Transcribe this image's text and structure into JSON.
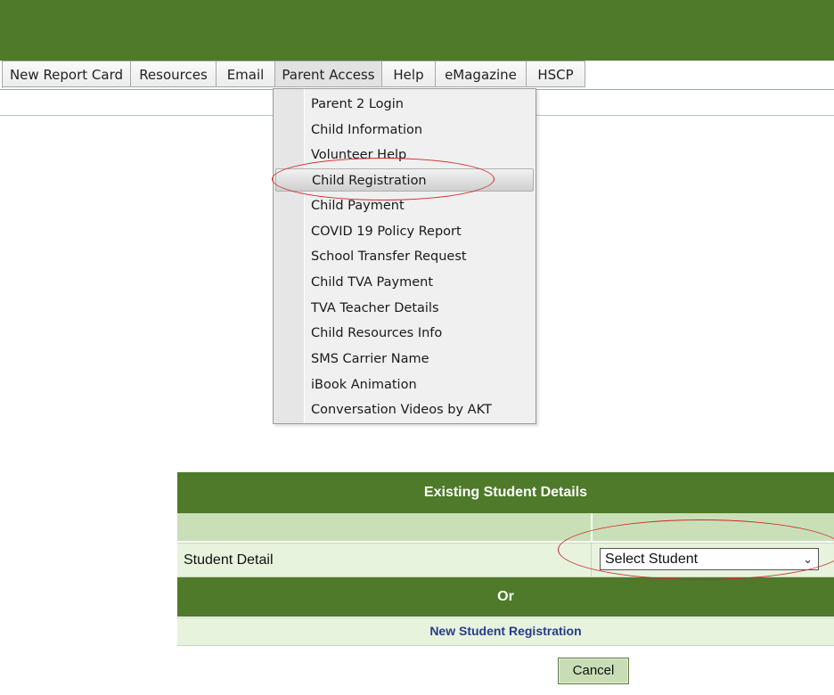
{
  "menu": {
    "items": [
      {
        "label": "New Report Card"
      },
      {
        "label": "Resources"
      },
      {
        "label": "Email"
      },
      {
        "label": "Parent Access"
      },
      {
        "label": "Help"
      },
      {
        "label": "eMagazine"
      },
      {
        "label": "HSCP"
      }
    ],
    "active": "Parent Access"
  },
  "dropdown": {
    "items": [
      "Parent 2 Login",
      "Child Information",
      "Volunteer Help",
      "Child Registration",
      "Child Payment",
      "COVID 19 Policy Report",
      "School Transfer Request",
      "Child TVA Payment",
      "TVA Teacher Details",
      "Child Resources Info",
      "SMS Carrier Name",
      "iBook Animation",
      "Conversation Videos by AKT"
    ],
    "highlighted": "Child Registration"
  },
  "panel": {
    "title": "Existing Student Details",
    "student_label": "Student Detail",
    "select_value": "Select Student",
    "or_label": "Or",
    "new_link": "New Student Registration"
  },
  "cancel_label": "Cancel",
  "colors": {
    "header_green": "#4e7a2a",
    "light_green": "#c9dfb8",
    "pale_green": "#e7f3dd",
    "annotation_red": "#cc2a2a"
  }
}
